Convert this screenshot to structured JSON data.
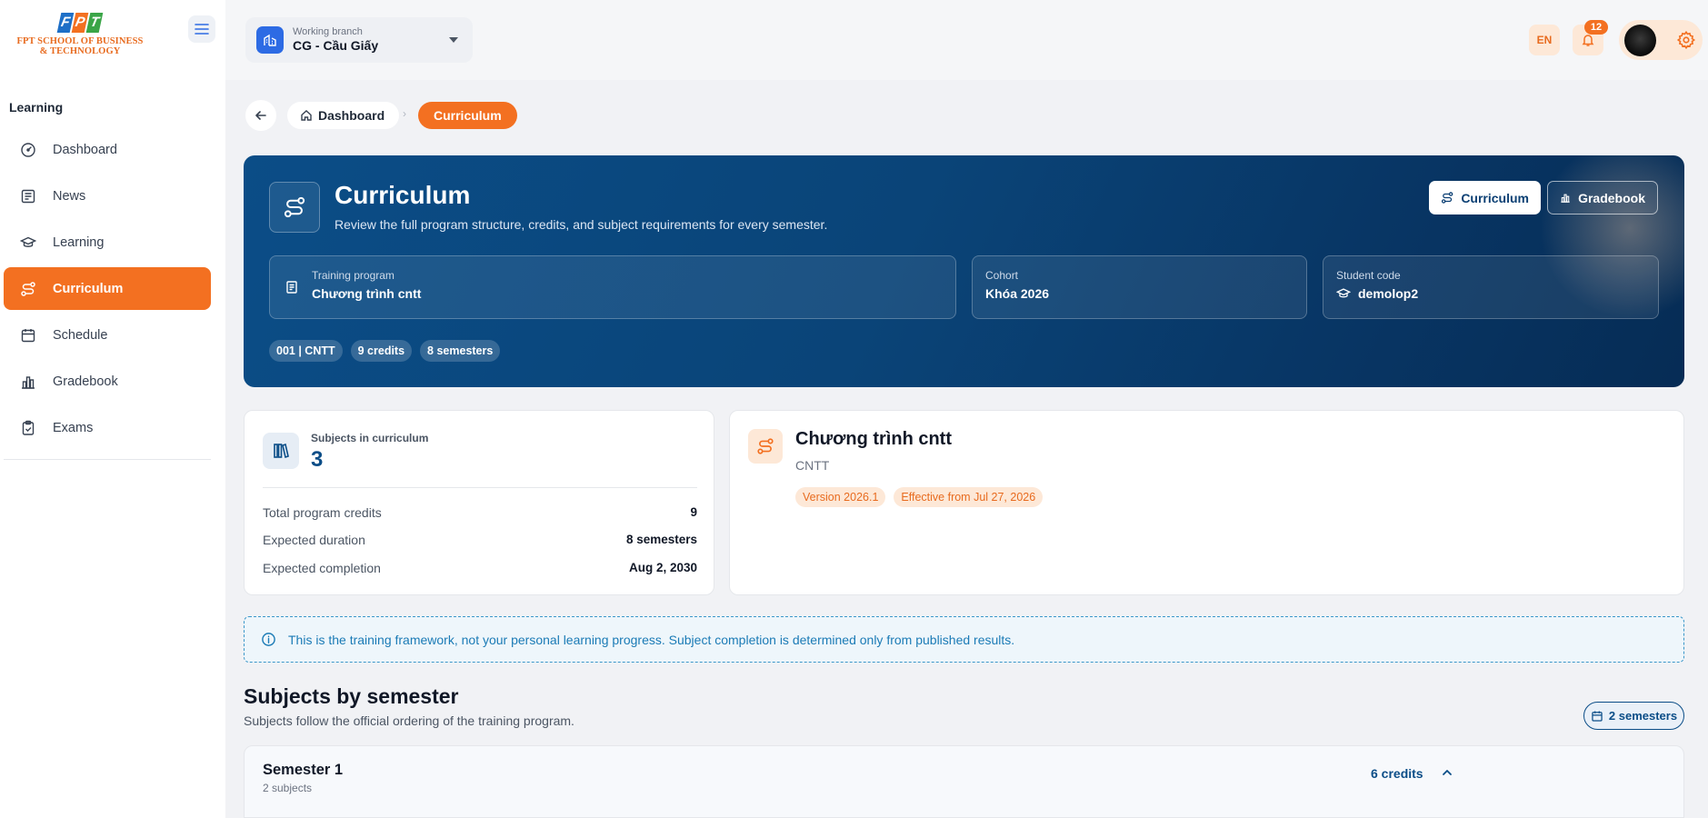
{
  "logo": {
    "mark": [
      "F",
      "P",
      "T"
    ],
    "line1": "FPT SCHOOL OF BUSINESS",
    "line2": "& TECHNOLOGY"
  },
  "sidebar": {
    "section": "Learning",
    "items": [
      {
        "label": "Dashboard",
        "icon": "gauge-icon"
      },
      {
        "label": "News",
        "icon": "newspaper-icon"
      },
      {
        "label": "Learning",
        "icon": "graduation-cap-icon"
      },
      {
        "label": "Curriculum",
        "icon": "route-icon",
        "active": true
      },
      {
        "label": "Schedule",
        "icon": "calendar-icon"
      },
      {
        "label": "Gradebook",
        "icon": "bar-chart-icon"
      },
      {
        "label": "Exams",
        "icon": "clipboard-check-icon"
      }
    ]
  },
  "topbar": {
    "branch_label": "Working branch",
    "branch_value": "CG - Cầu Giấy",
    "language": "EN",
    "notification_count": "12"
  },
  "breadcrumb": {
    "home": "Dashboard",
    "current": "Curriculum"
  },
  "hero": {
    "title": "Curriculum",
    "subtitle": "Review the full program structure, credits, and subject requirements for every semester.",
    "btn_curriculum": "Curriculum",
    "btn_gradebook": "Gradebook",
    "training_program_label": "Training program",
    "training_program_value": "Chương trình cntt",
    "cohort_label": "Cohort",
    "cohort_value": "Khóa 2026",
    "student_code_label": "Student code",
    "student_code_value": "demolop2",
    "chips": [
      "001 | CNTT",
      "9 credits",
      "8 semesters"
    ]
  },
  "stats": {
    "subjects_label": "Subjects in curriculum",
    "subjects_value": "3",
    "rows": [
      {
        "label": "Total program credits",
        "value": "9"
      },
      {
        "label": "Expected duration",
        "value": "8 semesters"
      },
      {
        "label": "Expected completion",
        "value": "Aug 2, 2030"
      }
    ]
  },
  "program": {
    "title": "Chương trình cntt",
    "code": "CNTT",
    "version": "Version 2026.1",
    "effective": "Effective from Jul 27, 2026"
  },
  "notice": "This is the training framework, not your personal learning progress. Subject completion is determined only from published results.",
  "subjects": {
    "title": "Subjects by semester",
    "subtitle": "Subjects follow the official ordering of the training program.",
    "semester_count": "2 semesters",
    "semesters": [
      {
        "title": "Semester 1",
        "subjects": "2 subjects",
        "credits": "6 credits"
      }
    ]
  },
  "colors": {
    "accent": "#f37021",
    "brand_blue": "#0b4d87",
    "info": "#1b7bb6"
  }
}
